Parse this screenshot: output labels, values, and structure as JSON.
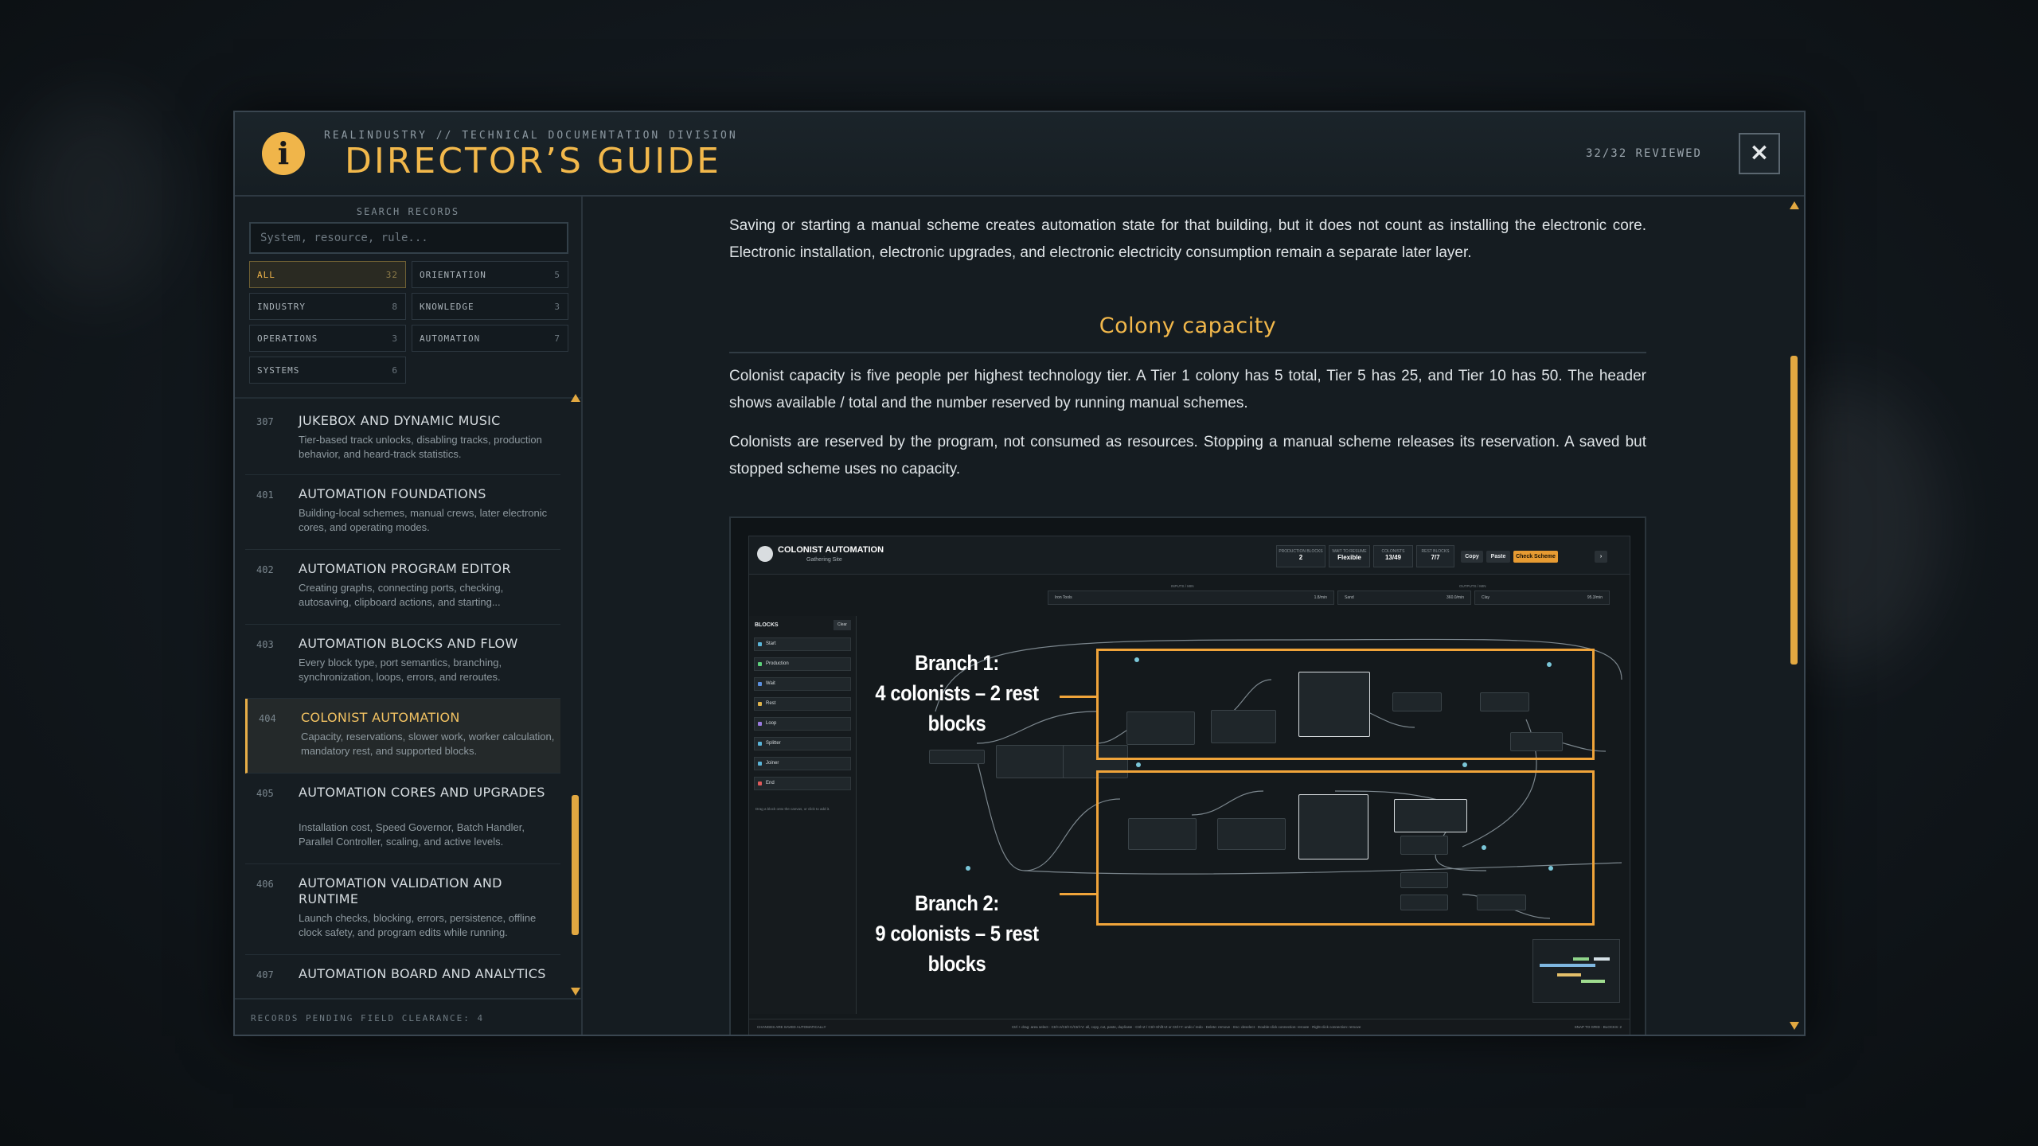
{
  "header": {
    "kicker": "REALINDUSTRY // TECHNICAL DOCUMENTATION DIVISION",
    "title": "DIRECTOR’S GUIDE",
    "reviewed": "32/32 REVIEWED",
    "close_label": "×"
  },
  "sidebar": {
    "search_label": "SEARCH RECORDS",
    "search_placeholder": "System, resource, rule...",
    "filters": [
      {
        "label": "ALL",
        "count": "32"
      },
      {
        "label": "ORIENTATION",
        "count": "5"
      },
      {
        "label": "INDUSTRY",
        "count": "8"
      },
      {
        "label": "KNOWLEDGE",
        "count": "3"
      },
      {
        "label": "OPERATIONS",
        "count": "3"
      },
      {
        "label": "AUTOMATION",
        "count": "7"
      },
      {
        "label": "SYSTEMS",
        "count": "6"
      }
    ],
    "records": [
      {
        "num": "307",
        "title": "JUKEBOX AND DYNAMIC MUSIC",
        "desc": "Tier-based track unlocks, disabling tracks, production behavior, and heard-track statistics."
      },
      {
        "num": "401",
        "title": "AUTOMATION FOUNDATIONS",
        "desc": "Building-local schemes, manual crews, later electronic cores, and operating modes."
      },
      {
        "num": "402",
        "title": "AUTOMATION PROGRAM EDITOR",
        "desc": "Creating graphs, connecting ports, checking, autosaving, clipboard actions, and starting..."
      },
      {
        "num": "403",
        "title": "AUTOMATION BLOCKS AND FLOW",
        "desc": "Every block type, port semantics, branching, synchronization, loops, errors, and reroutes."
      },
      {
        "num": "404",
        "title": "COLONIST AUTOMATION",
        "desc": "Capacity, reservations, slower work, worker calculation, mandatory rest, and supported blocks."
      },
      {
        "num": "405",
        "title": "AUTOMATION CORES AND UPGRADES",
        "desc": "Installation cost, Speed Governor, Batch Handler, Parallel Controller, scaling, and active levels."
      },
      {
        "num": "406",
        "title": "AUTOMATION VALIDATION AND RUNTIME",
        "desc": "Launch checks, blocking, errors, persistence, offline clock safety, and program edits while running."
      },
      {
        "num": "407",
        "title": "AUTOMATION BOARD AND ANALYTICS",
        "desc": ""
      }
    ],
    "footer": "RECORDS PENDING FIELD CLEARANCE: 4"
  },
  "content": {
    "para_top": "Saving or starting a manual scheme creates automation state for that building, but it does not count as installing the electronic core. Electronic installation, electronic upgrades, and electronic electricity consumption remain a separate later layer.",
    "section_title": "Colony capacity",
    "para_1": "Colonist capacity is five people per highest technology tier. A Tier 1 colony has 5 total, Tier 5 has 25, and Tier 10 has 50. The header shows available / total and the number reserved by running manual schemes.",
    "para_2": "Colonists are reserved by the program, not consumed as resources. Stopping a manual scheme releases its reservation. A saved but stopped scheme uses no capacity."
  },
  "figure": {
    "app_title": "COLONIST AUTOMATION",
    "app_subtitle": "Gathering Site",
    "stats": [
      {
        "k": "PRODUCTION BLOCKS",
        "v": "2"
      },
      {
        "k": "WAIT TO RESUME",
        "v": "Flexible"
      },
      {
        "k": "COLONISTS",
        "v": "13/49"
      },
      {
        "k": "REST BLOCKS",
        "v": "7/7"
      }
    ],
    "buttons": {
      "copy": "Copy",
      "paste": "Paste",
      "check": "Check Scheme"
    },
    "io": {
      "inputs_label": "INPUTS / MIN",
      "outputs_label": "OUTPUTS / MIN",
      "input_item": "Iron Tools",
      "input_rate": "1.8/min",
      "output_1": "Sand",
      "output_1_rate": "360.0/min",
      "output_2": "Clay",
      "output_2_rate": "95.3/min"
    },
    "blocks": {
      "head": "BLOCKS",
      "clear": "Clear",
      "items": [
        "Start",
        "Production",
        "Wait",
        "Rest",
        "Loop",
        "Splitter",
        "Joiner",
        "End"
      ],
      "colors": [
        "#5ab4d8",
        "#5dd17a",
        "#5a8fe0",
        "#e0b34a",
        "#9a7ae0",
        "#5ab4d8",
        "#5ab4d8",
        "#e05a5a"
      ],
      "hint": "Drag a block onto the canvas, or click to add it."
    },
    "branch_1": {
      "line1": "Branch 1:",
      "line2": "4 colonists – 2 rest blocks"
    },
    "branch_2": {
      "line1": "Branch 2:",
      "line2": "9 colonists – 5 rest blocks"
    },
    "footer_left": "CHANGES ARE SAVED AUTOMATICALLY",
    "footer_mid": "Ctrl + drag: area select · Ctrl+A/Ctrl+C/Ctrl+V: all, copy, cut, paste, duplicate · Ctrl+Z / Ctrl+Shift+Z or Ctrl+Y: undo / redo · Delete: remove · Esc: deselect · Double-click connection: reroute · Right-click connection: remove",
    "footer_right": "SNAP TO GRID · BLOCKS: 2"
  },
  "colors": {
    "accent": "#f2b84b",
    "branch": "#f0a43a",
    "panel": "#151c21"
  }
}
